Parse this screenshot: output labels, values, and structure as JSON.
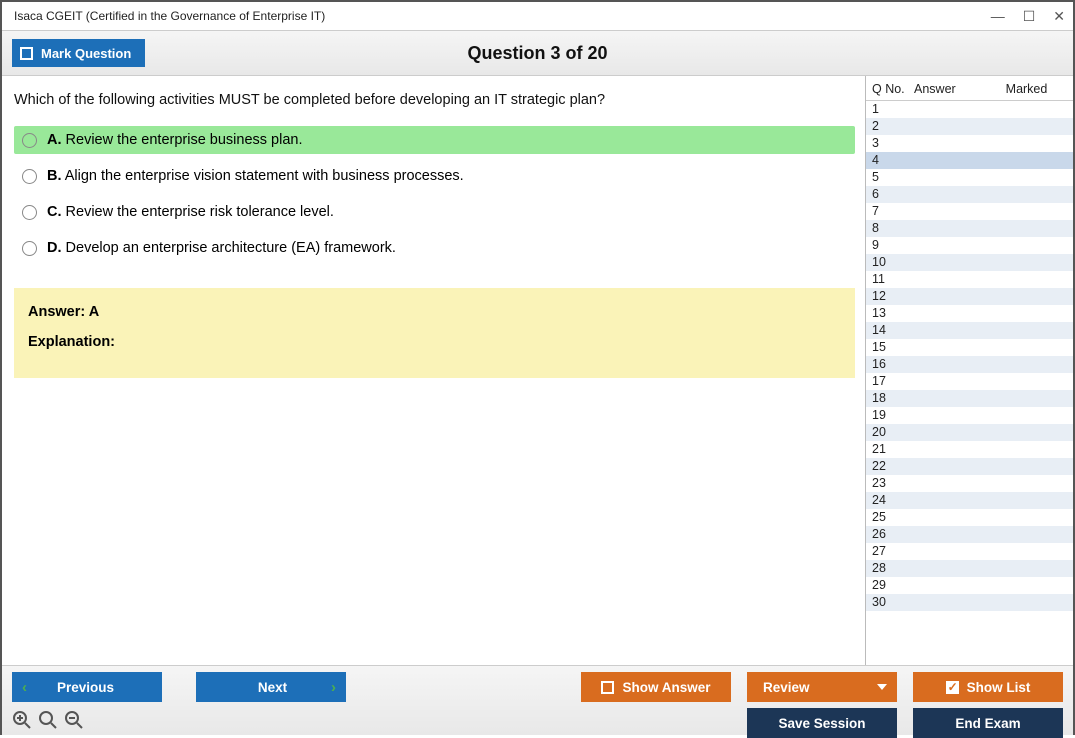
{
  "window": {
    "title": "Isaca CGEIT (Certified in the Governance of Enterprise IT)"
  },
  "header": {
    "mark_label": "Mark Question",
    "question_title": "Question 3 of 20"
  },
  "question": {
    "text": "Which of the following activities MUST be completed before developing an IT strategic plan?",
    "choices": [
      {
        "letter": "A.",
        "text": "Review the enterprise business plan.",
        "correct": true
      },
      {
        "letter": "B.",
        "text": "Align the enterprise vision statement with business processes.",
        "correct": false
      },
      {
        "letter": "C.",
        "text": "Review the enterprise risk tolerance level.",
        "correct": false
      },
      {
        "letter": "D.",
        "text": "Develop an enterprise architecture (EA) framework.",
        "correct": false
      }
    ],
    "answer_label": "Answer: A",
    "explanation_label": "Explanation:"
  },
  "sidebar": {
    "headers": {
      "qno": "Q No.",
      "answer": "Answer",
      "marked": "Marked"
    },
    "rows": [
      1,
      2,
      3,
      4,
      5,
      6,
      7,
      8,
      9,
      10,
      11,
      12,
      13,
      14,
      15,
      16,
      17,
      18,
      19,
      20,
      21,
      22,
      23,
      24,
      25,
      26,
      27,
      28,
      29,
      30
    ],
    "selected": 4
  },
  "footer": {
    "previous": "Previous",
    "next": "Next",
    "show_answer": "Show Answer",
    "review": "Review",
    "show_list": "Show List",
    "save_session": "Save Session",
    "end_exam": "End Exam"
  }
}
